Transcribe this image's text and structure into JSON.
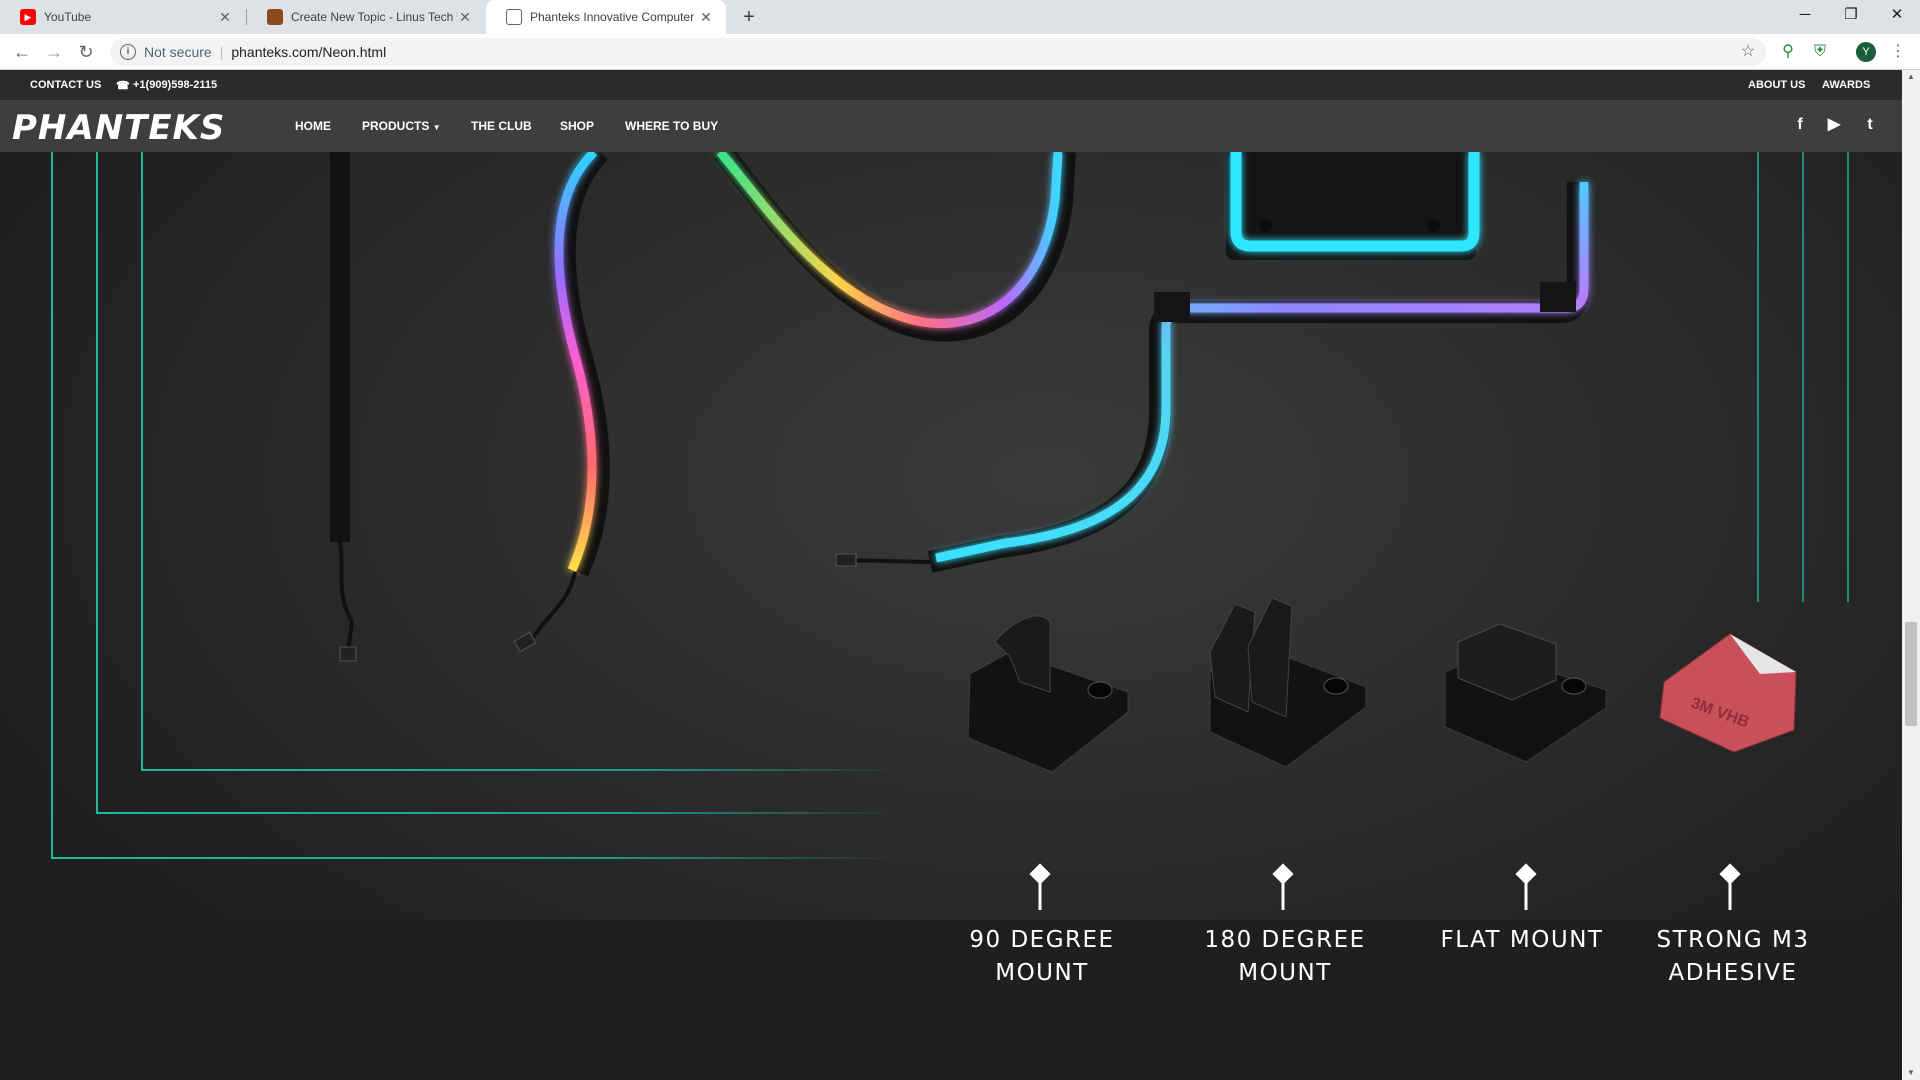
{
  "browser": {
    "tabs": [
      {
        "title": "YouTube",
        "icon": "youtube-icon"
      },
      {
        "title": "Create New Topic - Linus Tech Tips",
        "icon": "forum-icon"
      },
      {
        "title": "Phanteks Innovative Computer Hardware",
        "icon": "page-icon"
      }
    ],
    "security_label": "Not secure",
    "url": "phanteks.com/Neon.html",
    "profile_initial": "Y"
  },
  "site": {
    "topbar": {
      "contact": "CONTACT US",
      "phone": "+1(909)598-2115",
      "about": "ABOUT US",
      "awards": "AWARDS"
    },
    "logo": "PHANTEKS",
    "nav": [
      "HOME",
      "PRODUCTS",
      "THE CLUB",
      "SHOP",
      "WHERE TO BUY"
    ],
    "social_icons": [
      "facebook-icon",
      "youtube-icon",
      "twitter-icon"
    ]
  },
  "mounts": [
    {
      "line1": "90 DEGREE",
      "line2": "MOUNT"
    },
    {
      "line1": "180 DEGREE",
      "line2": "MOUNT"
    },
    {
      "line1": "FLAT MOUNT",
      "line2": ""
    },
    {
      "line1": "STRONG M3",
      "line2": "ADHESIVE"
    }
  ],
  "colors": {
    "accent_teal": "#1abc9c",
    "chrome_bg": "#dee1e6",
    "nav_bg": "#3e3e3e"
  }
}
